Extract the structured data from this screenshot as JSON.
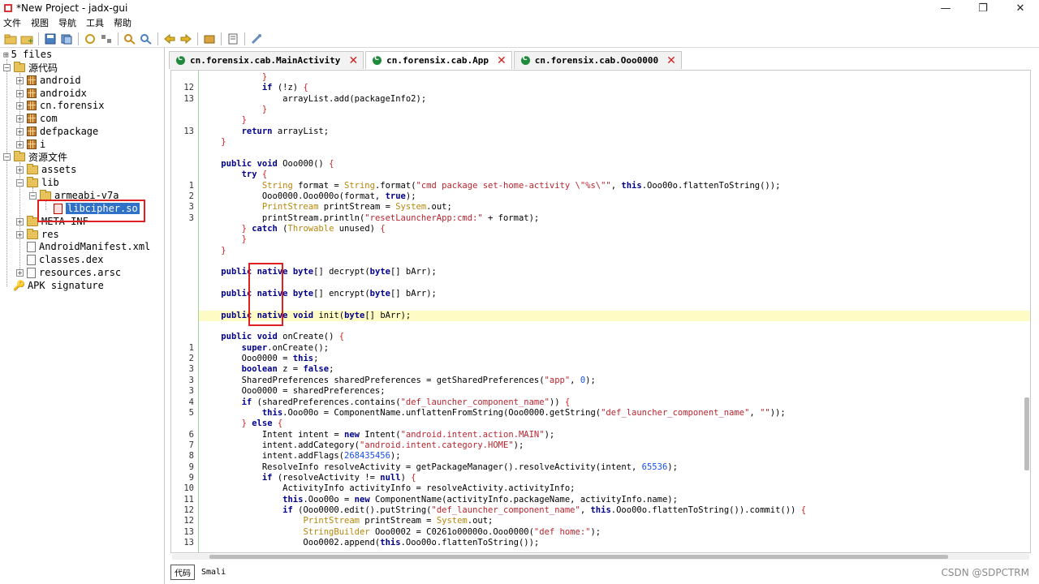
{
  "window": {
    "title": "*New Project - jadx-gui",
    "controls": [
      "—",
      "❐",
      "✕"
    ]
  },
  "menu": [
    "文件",
    "视图",
    "导航",
    "工具",
    "帮助"
  ],
  "tree": {
    "root": "5 files",
    "source_code": "源代码",
    "packages": [
      "android",
      "androidx",
      "cn.forensix",
      "com",
      "defpackage",
      "i"
    ],
    "resources": "资源文件",
    "assets": "assets",
    "lib": "lib",
    "armeabi": "armeabi-v7a",
    "libcipher": "libcipher.so",
    "meta_inf": "META-INF",
    "res": "res",
    "manifest": "AndroidManifest.xml",
    "classes": "classes.dex",
    "resources_arsc": "resources.arsc",
    "apk_signature": "APK signature"
  },
  "tabs": [
    {
      "label": "cn.forensix.cab.MainActivity"
    },
    {
      "label": "cn.forensix.cab.App"
    },
    {
      "label": "cn.forensix.cab.Ooo0000"
    }
  ],
  "code": [
    {
      "ln": "",
      "html": "            <span class='brace'>}</span>"
    },
    {
      "ln": "12",
      "html": "            <span class='kw'>if</span> (!z) <span class='brace'>{</span>"
    },
    {
      "ln": "13",
      "html": "                arrayList.add(packageInfo2);"
    },
    {
      "ln": "",
      "html": "            <span class='brace'>}</span>"
    },
    {
      "ln": "",
      "html": "        <span class='brace'>}</span>"
    },
    {
      "ln": "13",
      "html": "        <span class='kw'>return</span> arrayList;"
    },
    {
      "ln": "",
      "html": "    <span class='brace'>}</span>"
    },
    {
      "ln": "",
      "html": ""
    },
    {
      "ln": "",
      "html": "    <span class='kw'>public</span> <span class='kw'>void</span> Ooo000() <span class='brace'>{</span>"
    },
    {
      "ln": "",
      "html": "        <span class='kw'>try</span> <span class='brace'>{</span>"
    },
    {
      "ln": "1",
      "html": "            <span class='typ'>String</span> format = <span class='typ'>String</span>.format(<span class='str'>\"cmd package set-home-activity \\\"%s\\\"\"</span>, <span class='kw'>this</span>.Ooo00o.flattenToString());"
    },
    {
      "ln": "2",
      "html": "            Ooo0000.Ooo000o(format, <span class='kw'>true</span>);"
    },
    {
      "ln": "3",
      "html": "            <span class='typ'>PrintStream</span> printStream = <span class='typ'>System</span>.out;"
    },
    {
      "ln": "3",
      "html": "            printStream.println(<span class='str'>\"resetLauncherApp:cmd:\"</span> + format);"
    },
    {
      "ln": "",
      "html": "        <span class='brace'>}</span> <span class='kw'>catch</span> (<span class='typ'>Throwable</span> unused) <span class='brace'>{</span>"
    },
    {
      "ln": "",
      "html": "        <span class='brace'>}</span>"
    },
    {
      "ln": "",
      "html": "    <span class='brace'>}</span>"
    },
    {
      "ln": "",
      "html": ""
    },
    {
      "ln": "",
      "html": "    <span class='kw'>public</span> <span class='kw'>native</span> <span class='kw'>byte</span>[] decrypt(<span class='kw'>byte</span>[] bArr);"
    },
    {
      "ln": "",
      "html": ""
    },
    {
      "ln": "",
      "html": "    <span class='kw'>public</span> <span class='kw'>native</span> <span class='kw'>byte</span>[] encrypt(<span class='kw'>byte</span>[] bArr);"
    },
    {
      "ln": "",
      "html": ""
    },
    {
      "ln": "",
      "html": "    <span class='kw'>public</span> <span class='kw'>native</span> <span class='kw'>void</span> init(<span class='kw'>byte</span>[] bArr);",
      "hl": true
    },
    {
      "ln": "",
      "html": ""
    },
    {
      "ln": "",
      "html": "    <span class='kw'>public</span> <span class='kw'>void</span> onCreate() <span class='brace'>{</span>"
    },
    {
      "ln": "1",
      "html": "        <span class='kw'>super</span>.onCreate();"
    },
    {
      "ln": "2",
      "html": "        Ooo0000 = <span class='kw'>this</span>;"
    },
    {
      "ln": "3",
      "html": "        <span class='kw'>boolean</span> z = <span class='kw'>false</span>;"
    },
    {
      "ln": "3",
      "html": "        SharedPreferences sharedPreferences = getSharedPreferences(<span class='str'>\"app\"</span>, <span class='num'>0</span>);"
    },
    {
      "ln": "3",
      "html": "        Ooo0000 = sharedPreferences;"
    },
    {
      "ln": "4",
      "html": "        <span class='kw'>if</span> (sharedPreferences.contains(<span class='str'>\"def_launcher_component_name\"</span>)) <span class='brace'>{</span>"
    },
    {
      "ln": "5",
      "html": "            <span class='kw'>this</span>.Ooo00o = ComponentName.unflattenFromString(Ooo0000.getString(<span class='str'>\"def_launcher_component_name\"</span>, <span class='str'>\"\"</span>));"
    },
    {
      "ln": "",
      "html": "        <span class='brace'>}</span> <span class='kw'>else</span> <span class='brace'>{</span>"
    },
    {
      "ln": "6",
      "html": "            Intent intent = <span class='kw'>new</span> Intent(<span class='str'>\"android.intent.action.MAIN\"</span>);"
    },
    {
      "ln": "7",
      "html": "            intent.addCategory(<span class='str'>\"android.intent.category.HOME\"</span>);"
    },
    {
      "ln": "8",
      "html": "            intent.addFlags(<span class='num'>268435456</span>);"
    },
    {
      "ln": "9",
      "html": "            ResolveInfo resolveActivity = getPackageManager().resolveActivity(intent, <span class='num'>65536</span>);"
    },
    {
      "ln": "9",
      "html": "            <span class='kw'>if</span> (resolveActivity != <span class='kw'>null</span>) <span class='brace'>{</span>"
    },
    {
      "ln": "10",
      "html": "                ActivityInfo activityInfo = resolveActivity.activityInfo;"
    },
    {
      "ln": "11",
      "html": "                <span class='kw'>this</span>.Ooo00o = <span class='kw'>new</span> ComponentName(activityInfo.packageName, activityInfo.name);"
    },
    {
      "ln": "12",
      "html": "                <span class='kw'>if</span> (Ooo0000.edit().putString(<span class='str'>\"def_launcher_component_name\"</span>, <span class='kw'>this</span>.Ooo00o.flattenToString()).commit()) <span class='brace'>{</span>"
    },
    {
      "ln": "12",
      "html": "                    <span class='typ'>PrintStream</span> printStream = <span class='typ'>System</span>.out;"
    },
    {
      "ln": "13",
      "html": "                    <span class='typ'>StringBuilder</span> Ooo0002 = C0261o00000o.Ooo0000(<span class='str'>\"def home:\"</span>);"
    },
    {
      "ln": "13",
      "html": "                    Ooo0002.append(<span class='kw'>this</span>.Ooo00o.flattenToString());"
    }
  ],
  "bottom_tabs": [
    "代码",
    "Smali"
  ],
  "watermark": "CSDN @SDPCTRM"
}
